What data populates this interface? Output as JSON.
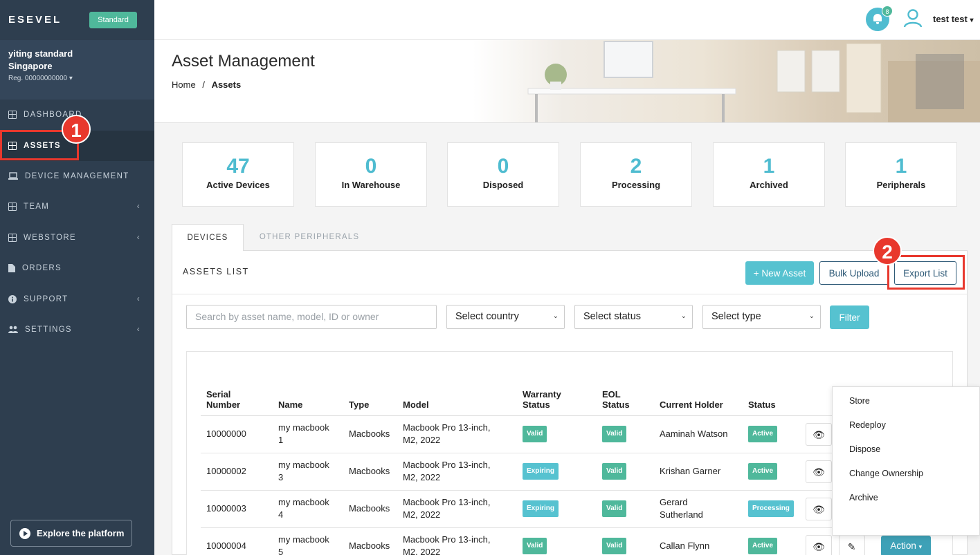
{
  "sidebar": {
    "brand": "ESEVEL",
    "plan_badge": "Standard",
    "org": {
      "name_line1": "yiting standard",
      "name_line2": "Singapore",
      "reg": "Reg. 00000000000"
    },
    "items": [
      {
        "label": "DASHBOARD",
        "icon": "grid-icon"
      },
      {
        "label": "ASSETS",
        "icon": "grid-icon"
      },
      {
        "label": "DEVICE MANAGEMENT",
        "icon": "laptop-icon"
      },
      {
        "label": "TEAM",
        "icon": "grid-icon"
      },
      {
        "label": "WEBSTORE",
        "icon": "grid-icon"
      },
      {
        "label": "ORDERS",
        "icon": "file-icon"
      },
      {
        "label": "SUPPORT",
        "icon": "info-icon"
      },
      {
        "label": "SETTINGS",
        "icon": "users-gear-icon"
      }
    ],
    "explore_label": "Explore the platform"
  },
  "annotations": {
    "mark1": "1",
    "mark2": "2",
    "color": "#e8382d"
  },
  "topbar": {
    "notification_count": "8",
    "user_name": "test test"
  },
  "header": {
    "title": "Asset Management",
    "crumb_home": "Home",
    "crumb_sep": "/",
    "crumb_current": "Assets"
  },
  "stats": [
    {
      "value": "47",
      "label": "Active Devices"
    },
    {
      "value": "0",
      "label": "In Warehouse"
    },
    {
      "value": "0",
      "label": "Disposed"
    },
    {
      "value": "2",
      "label": "Processing"
    },
    {
      "value": "1",
      "label": "Archived"
    },
    {
      "value": "1",
      "label": "Peripherals"
    }
  ],
  "tabs": [
    {
      "label": "DEVICES"
    },
    {
      "label": "OTHER PERIPHERALS"
    }
  ],
  "list": {
    "title": "ASSETS LIST",
    "new_asset": "+ New Asset",
    "bulk_upload": "Bulk Upload",
    "export_list": "Export List"
  },
  "filters": {
    "search_placeholder": "Search by asset name, model, ID or owner",
    "country": "Select country",
    "status": "Select status",
    "type": "Select type",
    "filter_button": "Filter"
  },
  "table": {
    "headers": {
      "serial1": "Serial",
      "serial2": "Number",
      "name": "Name",
      "type": "Type",
      "model": "Model",
      "warranty1": "Warranty",
      "warranty2": "Status",
      "eol1": "EOL",
      "eol2": "Status",
      "holder": "Current Holder",
      "status": "Status"
    },
    "rows": [
      {
        "serial": "10000000",
        "name1": "my macbook",
        "name2": "1",
        "type": "Macbooks",
        "model1": "Macbook Pro 13-inch,",
        "model2": "M2, 2022",
        "warranty": "Valid",
        "eol": "Valid",
        "holder1": "Aaminah Watson",
        "holder2": "",
        "status": "Active"
      },
      {
        "serial": "10000002",
        "name1": "my macbook",
        "name2": "3",
        "type": "Macbooks",
        "model1": "Macbook Pro 13-inch,",
        "model2": "M2, 2022",
        "warranty": "Expiring",
        "eol": "Valid",
        "holder1": "Krishan Garner",
        "holder2": "",
        "status": "Active"
      },
      {
        "serial": "10000003",
        "name1": "my macbook",
        "name2": "4",
        "type": "Macbooks",
        "model1": "Macbook Pro 13-inch,",
        "model2": "M2, 2022",
        "warranty": "Expiring",
        "eol": "Valid",
        "holder1": "Gerard",
        "holder2": "Sutherland",
        "status": "Processing"
      },
      {
        "serial": "10000004",
        "name1": "my macbook",
        "name2": "5",
        "type": "Macbooks",
        "model1": "Macbook Pro 13-inch,",
        "model2": "M2, 2022",
        "warranty": "Valid",
        "eol": "Valid",
        "holder1": "Callan Flynn",
        "holder2": "",
        "status": "Active"
      }
    ],
    "action_label": "Action"
  },
  "action_menu": [
    "Store",
    "Redeploy",
    "Dispose",
    "Change Ownership",
    "Archive"
  ],
  "colors": {
    "teal": "#4fbcd0",
    "green": "#4fb89b",
    "sidebar": "#2e3e4f"
  }
}
